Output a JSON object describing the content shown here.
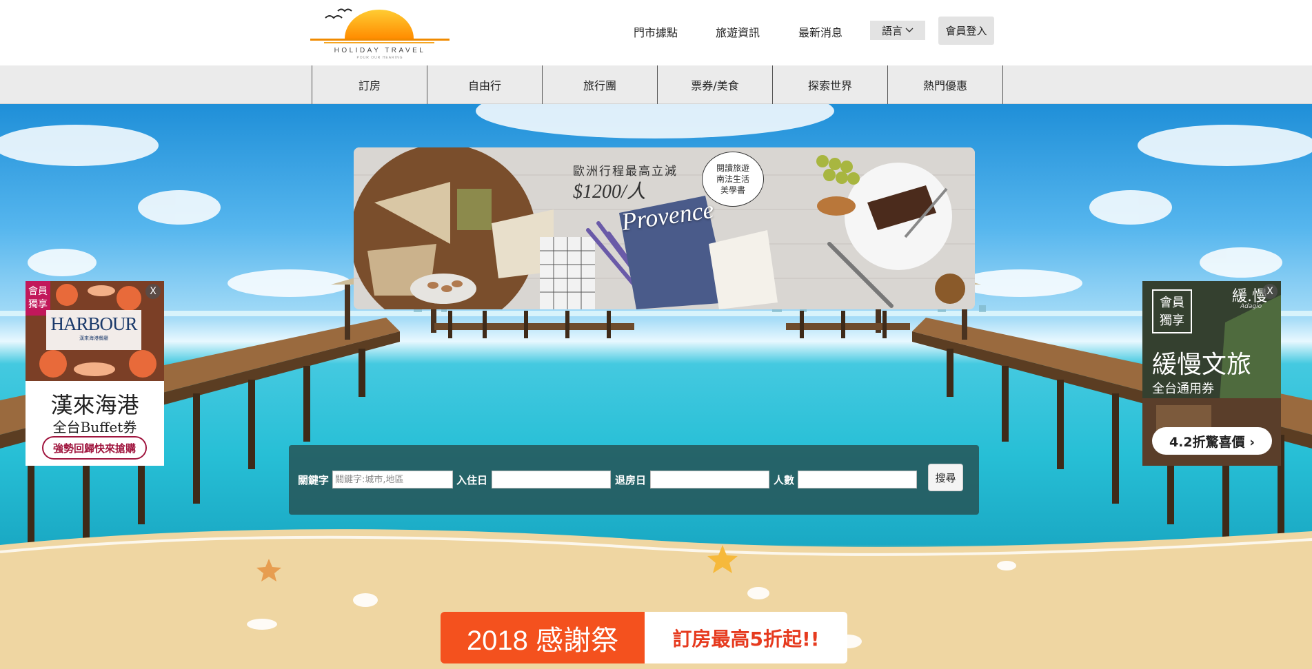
{
  "header": {
    "logo_text": "HOLIDAY TRAVEL",
    "logo_sub": "POUR OUR HEARING",
    "links": [
      "門市據點",
      "旅遊資訊",
      "最新消息"
    ],
    "language_label": "語言",
    "login_label": "會員登入"
  },
  "nav": {
    "items": [
      "訂房",
      "自由行",
      "旅行團",
      "票券/美食",
      "探索世界",
      "熱門優惠"
    ]
  },
  "banner": {
    "headline": "歐洲行程最高立減",
    "price": "$1200/人",
    "badge_lines": [
      "閱讀旅遊",
      "南法生活",
      "美學書"
    ],
    "book_text": "Provence"
  },
  "ad_left": {
    "badge": "會員獨享",
    "brand": "HARBOUR",
    "brand_sub": "漢來海港餐廳",
    "title": "漢來海港",
    "subtitle": "全台Buffet券",
    "cta": "強勢回歸快來搶購",
    "close": "X"
  },
  "ad_right": {
    "badge": "會員獨享",
    "logo": "緩.慢",
    "logo_sub": "Adagio",
    "title": "緩慢文旅",
    "subtitle": "全台通用券",
    "cta": "4.2折驚喜價 ›",
    "close": "X"
  },
  "search": {
    "keyword_label": "關鍵字",
    "keyword_placeholder": "關鍵字:城市,地區",
    "checkin_label": "入住日",
    "checkout_label": "退房日",
    "guests_label": "人數",
    "button_label": "搜尋"
  },
  "promo": {
    "left": "2018 感謝祭",
    "right": "訂房最高5折起!!"
  }
}
